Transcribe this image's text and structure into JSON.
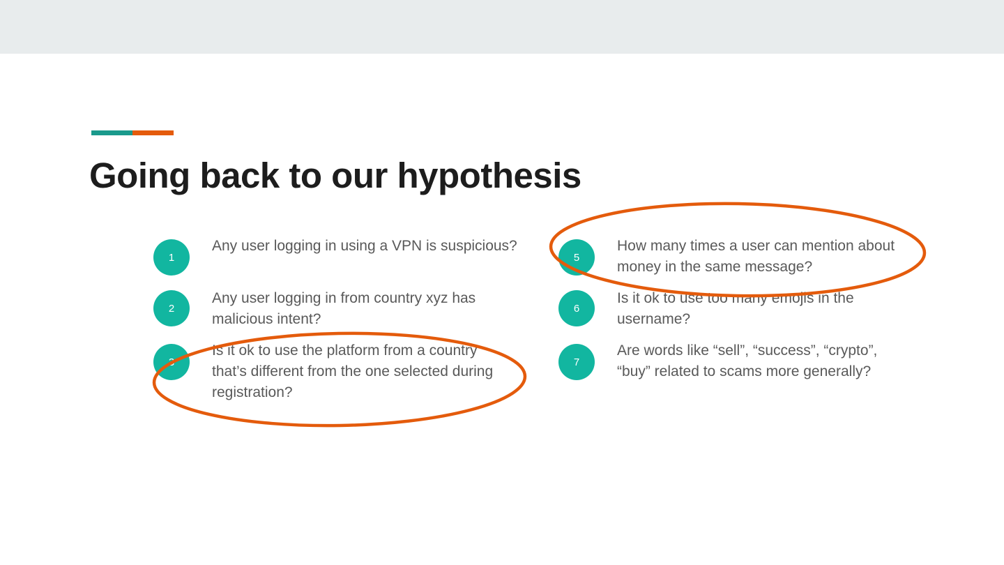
{
  "slide": {
    "title": "Going back to our hypothesis",
    "items": [
      {
        "number": "1",
        "text": "Any user logging in using a VPN is suspicious?"
      },
      {
        "number": "2",
        "text": "Any user logging in from country xyz has malicious intent?"
      },
      {
        "number": "3",
        "text": "Is it ok to use the platform from a country that’s different from the one selected during registration?"
      },
      {
        "number": "5",
        "text": "How many times a user can mention about money in the same message?"
      },
      {
        "number": "6",
        "text": "Is it ok to use too many emojis in the username?"
      },
      {
        "number": "7",
        "text": "Are words like “sell”, “success”, “crypto”, “buy” related to scams more generally?"
      }
    ]
  },
  "colors": {
    "header_band": "#e8eced",
    "accent_teal": "#1a9a8c",
    "accent_orange": "#e45b0c",
    "badge": "#12b6a0",
    "circle_annotation": "#e45b0c",
    "title": "#1d1d1d",
    "body_text": "#595959"
  }
}
